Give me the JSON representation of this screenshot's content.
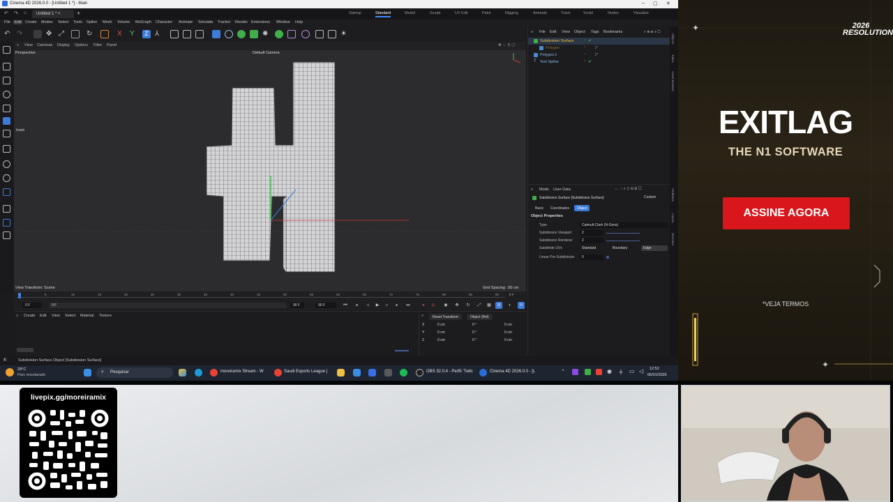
{
  "window": {
    "title": "Cinema 4D 2026.0.0 - [Untitled 1 *] - Main",
    "doc_tab": "Untitled 1 *"
  },
  "layouts": [
    "Startup",
    "Standard",
    "Model",
    "Sculpt",
    "UV Edit",
    "Paint",
    "Rigging",
    "Animate",
    "Track",
    "Script",
    "Nodes",
    "Visualize"
  ],
  "menu": [
    "File",
    "Edit",
    "Create",
    "Modes",
    "Select",
    "Tools",
    "Spline",
    "Mesh",
    "Volume",
    "MoGraph",
    "Character",
    "Animate",
    "Simulate",
    "Tracker",
    "Render",
    "Extensions",
    "Window",
    "Help"
  ],
  "viewport": {
    "menu": [
      "View",
      "Cameras",
      "Display",
      "Options",
      "Filter",
      "Panel"
    ],
    "label": "Perspective",
    "camera": "Default Camera",
    "inset": "Inset",
    "view_transform": "View Transform: Scene",
    "grid_spacing": "Grid Spacing : 50 cm"
  },
  "timeline": {
    "ticks": [
      "0",
      "5",
      "10",
      "15",
      "20",
      "25",
      "30",
      "35",
      "40",
      "45",
      "50",
      "55",
      "60",
      "65",
      "70",
      "75",
      "80",
      "85",
      "90"
    ],
    "start": "0 F",
    "current": "0 F",
    "end1": "90 F",
    "end2": "90 F",
    "frame_display": "0 F"
  },
  "materials_menu": [
    "Create",
    "Edit",
    "View",
    "Select",
    "Material",
    "Texture"
  ],
  "coords": {
    "reset": "Reset Transform",
    "mode": "Object (Rel)",
    "rows": [
      {
        "axis": "X",
        "pos": "0 cm",
        "rot": "0 °",
        "scale": "0 cm"
      },
      {
        "axis": "Y",
        "pos": "0 cm",
        "rot": "0 °",
        "scale": "0 cm"
      },
      {
        "axis": "Z",
        "pos": "0 cm",
        "rot": "0 °",
        "scale": "0 cm"
      }
    ]
  },
  "status": "Subdivision Surface Object [Subdivision Surface]",
  "objects": {
    "menu": [
      "File",
      "Edit",
      "View",
      "Object",
      "Tags",
      "Bookmarks"
    ],
    "items": [
      {
        "name": "Subdivision Surface",
        "color": "#f0c040"
      },
      {
        "name": "Polygon",
        "color": "#8b6b2a"
      },
      {
        "name": "Polygon.1",
        "color": "#8fb8e8"
      },
      {
        "name": "Text Spline",
        "color": "#8fb8e8"
      }
    ]
  },
  "attributes": {
    "menu": [
      "Mode",
      "User Data"
    ],
    "header": "Subdivision Surface [Subdivision Surface]",
    "preset": "Custom",
    "tabs": [
      "Basic",
      "Coordinates",
      "Object"
    ],
    "section": "Object Properties",
    "props": [
      {
        "label": "Type",
        "value": "Catmull-Clark (N-Gons)"
      },
      {
        "label": "Subdivision Viewport",
        "value": "2"
      },
      {
        "label": "Subdivision Renderer",
        "value": "2"
      },
      {
        "label": "Subdivide UVs",
        "value": "Standard"
      },
      {
        "label": "Linear Pre-Subdivision",
        "value": "0"
      }
    ],
    "uv_options": [
      "Standard",
      "Boundary",
      "Edge"
    ]
  },
  "right_tabs": [
    "Objects",
    "Takes",
    "Asset Browser",
    "Attributes",
    "Layers",
    "Structure"
  ],
  "taskbar": {
    "weather_temp": "29°C",
    "weather_desc": "Parc ensolarado",
    "search": "Pesquisar",
    "apps": [
      "moreiramix Stream - W",
      "Saudi Esports League |",
      "OBS 32.0.4 - Perfil: Twitc",
      "Cinema 4D 2026.0.0 - [L"
    ],
    "time": "12:52",
    "date": "05/01/2026"
  },
  "ad": {
    "badge": "2026 RESOLUTION",
    "brand": "EXITLAG",
    "tagline": "THE N1 SOFTWARE",
    "cta": "ASSINE AGORA",
    "terms": "*VEJA TERMOS"
  },
  "overlay": {
    "qr_url": "livepix.gg/moreiramix"
  },
  "colors": {
    "accent": "#3d7bd9",
    "cta_red": "#d9161b",
    "ad_gold": "#c8a050"
  }
}
